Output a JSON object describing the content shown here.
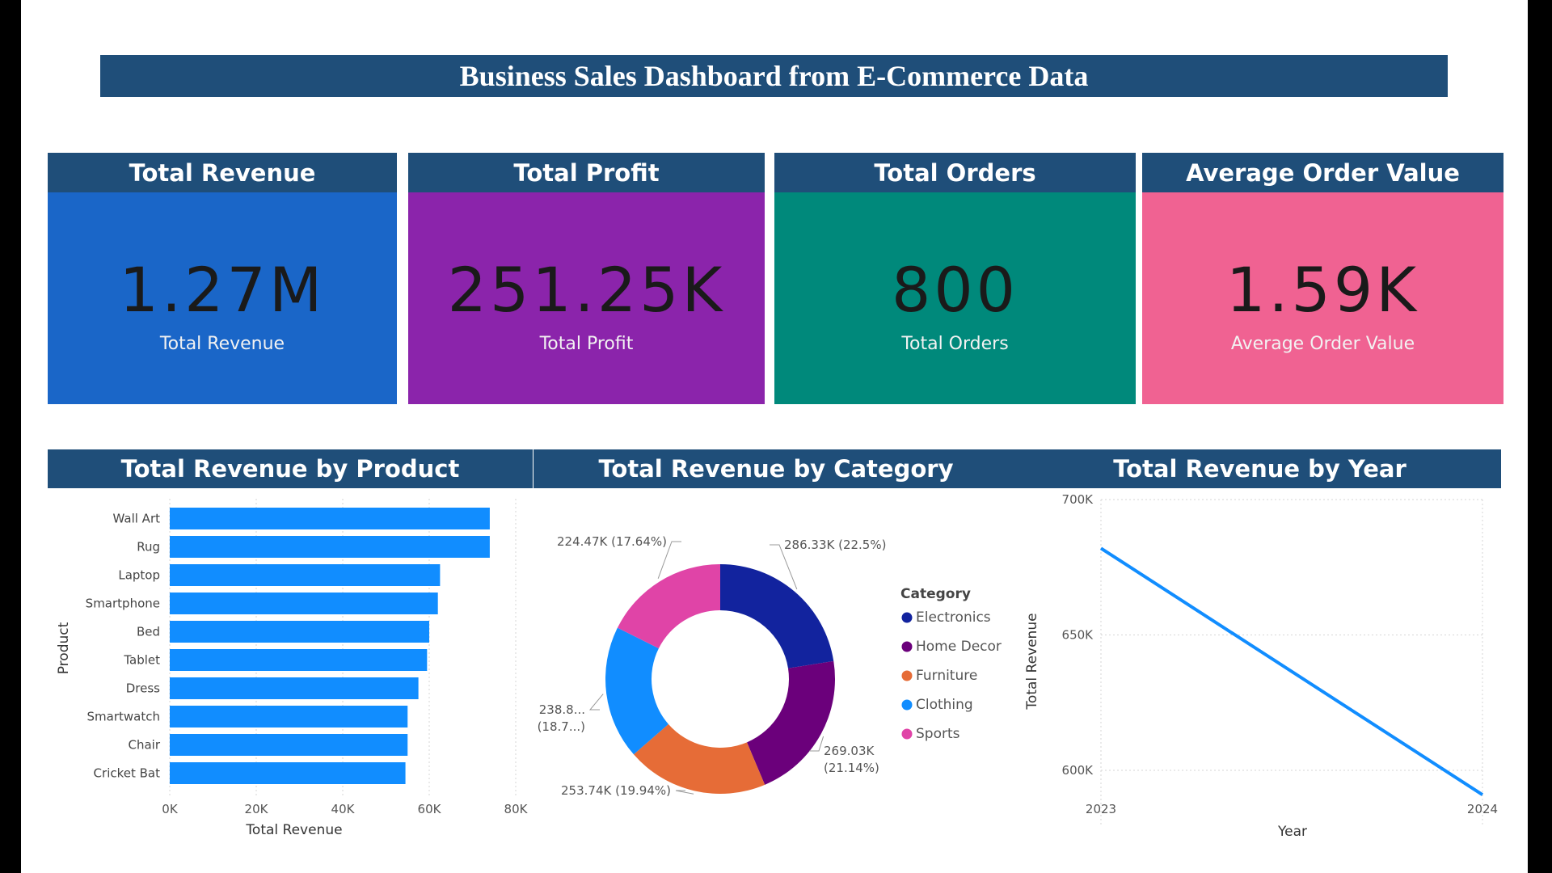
{
  "dashboard": {
    "title": "Business Sales Dashboard from E-Commerce Data"
  },
  "kpis": [
    {
      "header": "Total Revenue",
      "value": "1.27M",
      "label": "Total Revenue",
      "color": "#1a66c8"
    },
    {
      "header": "Total Profit",
      "value": "251.25K",
      "label": "Total Profit",
      "color": "#8b24ab"
    },
    {
      "header": "Total Orders",
      "value": "800",
      "label": "Total Orders",
      "color": "#00897b"
    },
    {
      "header": "Average Order Value",
      "value": "1.59K",
      "label": "Average Order Value",
      "color": "#f06292"
    }
  ],
  "charts": {
    "product_title": "Total Revenue by Product",
    "category_title": "Total Revenue by Category",
    "year_title": "Total Revenue by Year"
  },
  "chart_data": [
    {
      "type": "bar",
      "orientation": "horizontal",
      "title": "Total Revenue by Product",
      "xlabel": "Total Revenue",
      "ylabel": "Product",
      "categories": [
        "Wall Art",
        "Rug",
        "Laptop",
        "Smartphone",
        "Bed",
        "Tablet",
        "Dress",
        "Smartwatch",
        "Chair",
        "Cricket Bat"
      ],
      "values": [
        74000,
        74000,
        62500,
        62000,
        60000,
        59500,
        57500,
        55000,
        55000,
        54500
      ],
      "xlim": [
        0,
        80000
      ],
      "xticks": [
        "0K",
        "20K",
        "40K",
        "60K",
        "80K"
      ],
      "color": "#118dff",
      "grid": true
    },
    {
      "type": "pie",
      "variant": "donut",
      "title": "Total Revenue by Category",
      "legend_title": "Category",
      "legend_position": "right",
      "slices": [
        {
          "name": "Electronics",
          "value": 286330,
          "label": "286.33K (22.5%)",
          "color": "#12239e"
        },
        {
          "name": "Home Decor",
          "value": 269030,
          "label": "269.03K",
          "label2": "(21.14%)",
          "color": "#6b007b"
        },
        {
          "name": "Furniture",
          "value": 253740,
          "label": "253.74K (19.94%)",
          "color": "#e66c37"
        },
        {
          "name": "Clothing",
          "value": 238800,
          "label": "238.8...",
          "label2": "(18.7...)",
          "color": "#118dff"
        },
        {
          "name": "Sports",
          "value": 224470,
          "label": "224.47K (17.64%)",
          "color": "#e044a7"
        }
      ]
    },
    {
      "type": "line",
      "title": "Total Revenue by Year",
      "xlabel": "Year",
      "ylabel": "Total Revenue",
      "x": [
        "2023",
        "2024"
      ],
      "values": [
        682000,
        591000
      ],
      "ylim": [
        580000,
        700000
      ],
      "yticks": [
        "600K",
        "650K",
        "700K"
      ],
      "color": "#118dff",
      "grid": true
    }
  ]
}
